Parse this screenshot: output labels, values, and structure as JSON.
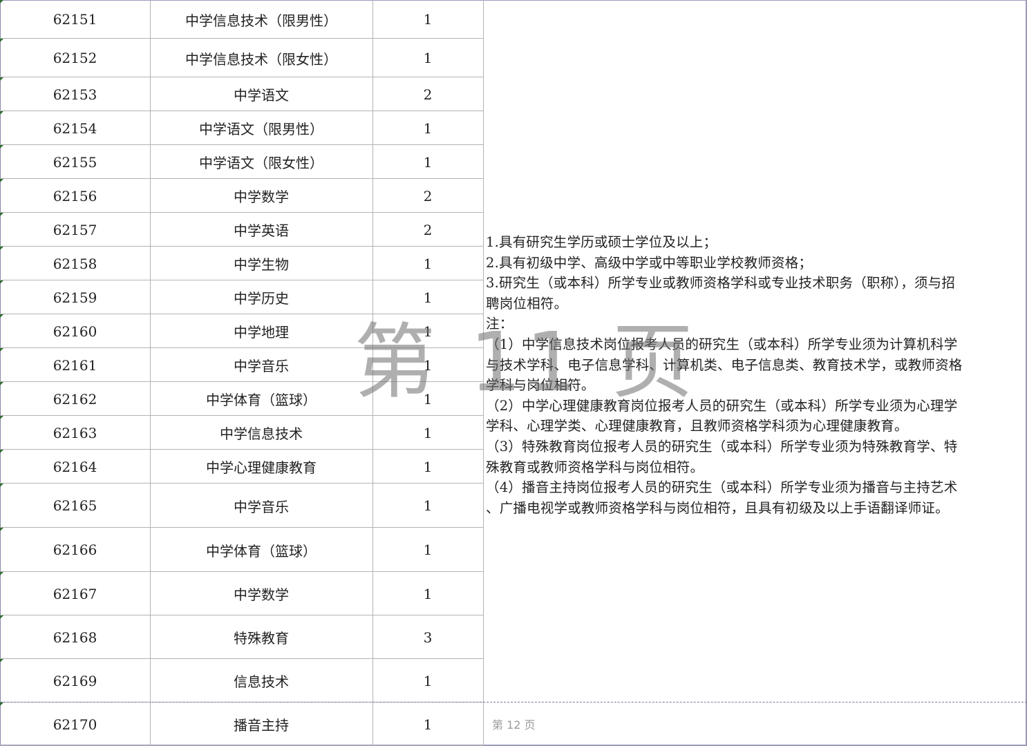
{
  "table": {
    "rows": [
      {
        "code": "62151",
        "position": "中学信息技术（限男性）",
        "count": "1"
      },
      {
        "code": "62152",
        "position": "中学信息技术（限女性）",
        "count": "1"
      },
      {
        "code": "62153",
        "position": "中学语文",
        "count": "2"
      },
      {
        "code": "62154",
        "position": "中学语文（限男性）",
        "count": "1"
      },
      {
        "code": "62155",
        "position": "中学语文（限女性）",
        "count": "1"
      },
      {
        "code": "62156",
        "position": "中学数学",
        "count": "2"
      },
      {
        "code": "62157",
        "position": "中学英语",
        "count": "2"
      },
      {
        "code": "62158",
        "position": "中学生物",
        "count": "1"
      },
      {
        "code": "62159",
        "position": "中学历史",
        "count": "1"
      },
      {
        "code": "62160",
        "position": "中学地理",
        "count": "1"
      },
      {
        "code": "62161",
        "position": "中学音乐",
        "count": "1"
      },
      {
        "code": "62162",
        "position": "中学体育（篮球）",
        "count": "1"
      },
      {
        "code": "62163",
        "position": "中学信息技术",
        "count": "1"
      },
      {
        "code": "62164",
        "position": "中学心理健康教育",
        "count": "1"
      },
      {
        "code": "62165",
        "position": "中学音乐",
        "count": "1"
      },
      {
        "code": "62166",
        "position": "中学体育（篮球）",
        "count": "1"
      },
      {
        "code": "62167",
        "position": "中学数学",
        "count": "1"
      },
      {
        "code": "62168",
        "position": "特殊教育",
        "count": "3"
      },
      {
        "code": "62169",
        "position": "信息技术",
        "count": "1"
      },
      {
        "code": "62170",
        "position": "播音主持",
        "count": "1"
      }
    ]
  },
  "requirements": {
    "lines": [
      "1.具有研究生学历或硕士学位及以上；",
      "2.具有初级中学、高级中学或中等职业学校教师资格；",
      "3.研究生（或本科）所学专业或教师资格学科或专业技术职务（职称），须与招",
      "聘岗位相符。",
      "注：",
      "（1）中学信息技术岗位报考人员的研究生（或本科）所学专业须为计算机科学",
      "与技术学科、电子信息学科、计算机类、电子信息类、教育技术学，或教师资格",
      "学科与岗位相符。",
      "（2）中学心理健康教育岗位报考人员的研究生（或本科）所学专业须为心理学",
      "学科、心理学类、心理健康教育，且教师资格学科须为心理健康教育。",
      "（3）特殊教育岗位报考人员的研究生（或本科）所学专业须为特殊教育学、特",
      "殊教育或教师资格学科与岗位相符。",
      "（4）播音主持岗位报考人员的研究生（或本科）所学专业须为播音与主持艺术",
      "、广播电视学或教师资格学科与岗位相符，且具有初级及以上手语翻译师证。"
    ]
  },
  "watermark": "第 11 页",
  "footer": {
    "page_label": "第 12 页"
  },
  "colors": {
    "grid": "#b3b3b3",
    "text": "#222222",
    "watermark": "#6e6e6e",
    "footer": "#9a9a9a",
    "row_marker": "#2e6b2e"
  }
}
